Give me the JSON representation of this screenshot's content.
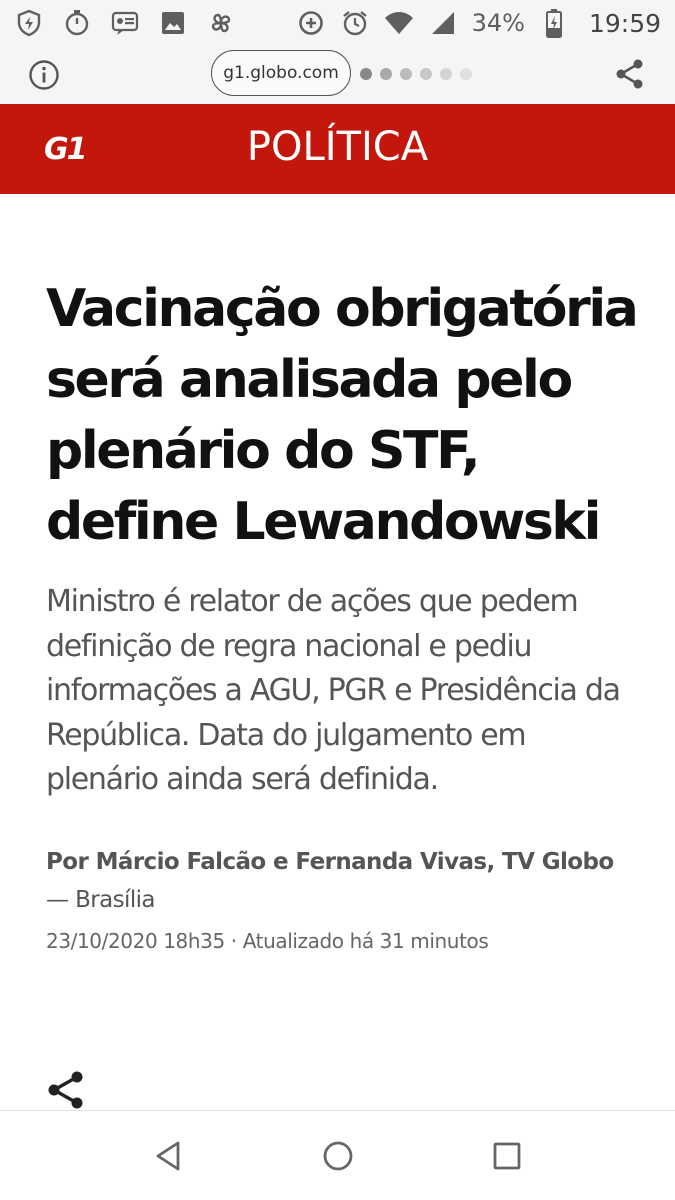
{
  "status_bar": {
    "battery_percent": "34%",
    "time": "19:59",
    "icons_left": [
      "shield-icon",
      "timer-icon",
      "message-icon",
      "image-icon",
      "pinwheel-icon"
    ],
    "icons_right": [
      "data-saver-icon",
      "alarm-icon",
      "wifi-icon",
      "signal-icon",
      "battery-icon"
    ]
  },
  "browser": {
    "url": "g1.globo.com",
    "dot_colors": [
      "#888888",
      "#aaaaaa",
      "#bbbbbb",
      "#c8c8c8",
      "#d4d4d4",
      "#e0e0e0"
    ]
  },
  "section": {
    "logo_text": "G1",
    "title": "POLÍTICA",
    "color": "#c4170c"
  },
  "article": {
    "headline": "Vacinação obrigatória será analisada pelo plenário do STF, define Lewandowski",
    "subtitle": "Ministro é relator de ações que pedem definição de regra nacional e pediu informações a AGU, PGR e Presidência da República. Data do julgamento em plenário ainda será definida.",
    "authors": "Por Márcio Falcão e Fernanda Vivas, TV Globo",
    "location": "— Brasília",
    "date": "23/10/2020 18h35",
    "separator": "·",
    "updated": "Atualizado há 31 minutos"
  },
  "nav_bar": {
    "buttons": [
      "back-button",
      "home-button",
      "recents-button"
    ]
  }
}
